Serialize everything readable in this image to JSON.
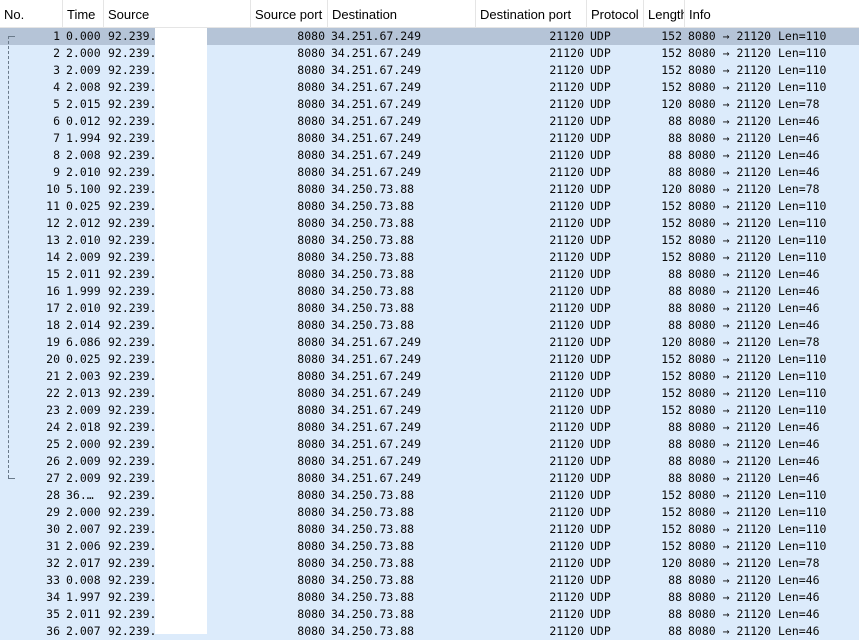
{
  "columns": {
    "no": "No.",
    "time": "Time",
    "source": "Source",
    "source_port": "Source port",
    "destination": "Destination",
    "destination_port": "Destination port",
    "protocol": "Protocol",
    "length": "Length",
    "info": "Info"
  },
  "rows": [
    {
      "no": "1",
      "time": "0.000",
      "src": "92.239.",
      "sport": "8080",
      "dst": "34.251.67.249",
      "dport": "21120",
      "proto": "UDP",
      "len": "152",
      "info": "8080 → 21120 Len=110"
    },
    {
      "no": "2",
      "time": "2.000",
      "src": "92.239.",
      "sport": "8080",
      "dst": "34.251.67.249",
      "dport": "21120",
      "proto": "UDP",
      "len": "152",
      "info": "8080 → 21120 Len=110"
    },
    {
      "no": "3",
      "time": "2.009",
      "src": "92.239.",
      "sport": "8080",
      "dst": "34.251.67.249",
      "dport": "21120",
      "proto": "UDP",
      "len": "152",
      "info": "8080 → 21120 Len=110"
    },
    {
      "no": "4",
      "time": "2.008",
      "src": "92.239.",
      "sport": "8080",
      "dst": "34.251.67.249",
      "dport": "21120",
      "proto": "UDP",
      "len": "152",
      "info": "8080 → 21120 Len=110"
    },
    {
      "no": "5",
      "time": "2.015",
      "src": "92.239.",
      "sport": "8080",
      "dst": "34.251.67.249",
      "dport": "21120",
      "proto": "UDP",
      "len": "120",
      "info": "8080 → 21120 Len=78"
    },
    {
      "no": "6",
      "time": "0.012",
      "src": "92.239.",
      "sport": "8080",
      "dst": "34.251.67.249",
      "dport": "21120",
      "proto": "UDP",
      "len": "88",
      "info": "8080 → 21120 Len=46"
    },
    {
      "no": "7",
      "time": "1.994",
      "src": "92.239.",
      "sport": "8080",
      "dst": "34.251.67.249",
      "dport": "21120",
      "proto": "UDP",
      "len": "88",
      "info": "8080 → 21120 Len=46"
    },
    {
      "no": "8",
      "time": "2.008",
      "src": "92.239.",
      "sport": "8080",
      "dst": "34.251.67.249",
      "dport": "21120",
      "proto": "UDP",
      "len": "88",
      "info": "8080 → 21120 Len=46"
    },
    {
      "no": "9",
      "time": "2.010",
      "src": "92.239.",
      "sport": "8080",
      "dst": "34.251.67.249",
      "dport": "21120",
      "proto": "UDP",
      "len": "88",
      "info": "8080 → 21120 Len=46"
    },
    {
      "no": "10",
      "time": "5.100",
      "src": "92.239.",
      "sport": "8080",
      "dst": "34.250.73.88",
      "dport": "21120",
      "proto": "UDP",
      "len": "120",
      "info": "8080 → 21120 Len=78"
    },
    {
      "no": "11",
      "time": "0.025",
      "src": "92.239.",
      "sport": "8080",
      "dst": "34.250.73.88",
      "dport": "21120",
      "proto": "UDP",
      "len": "152",
      "info": "8080 → 21120 Len=110"
    },
    {
      "no": "12",
      "time": "2.012",
      "src": "92.239.",
      "sport": "8080",
      "dst": "34.250.73.88",
      "dport": "21120",
      "proto": "UDP",
      "len": "152",
      "info": "8080 → 21120 Len=110"
    },
    {
      "no": "13",
      "time": "2.010",
      "src": "92.239.",
      "sport": "8080",
      "dst": "34.250.73.88",
      "dport": "21120",
      "proto": "UDP",
      "len": "152",
      "info": "8080 → 21120 Len=110"
    },
    {
      "no": "14",
      "time": "2.009",
      "src": "92.239.",
      "sport": "8080",
      "dst": "34.250.73.88",
      "dport": "21120",
      "proto": "UDP",
      "len": "152",
      "info": "8080 → 21120 Len=110"
    },
    {
      "no": "15",
      "time": "2.011",
      "src": "92.239.",
      "sport": "8080",
      "dst": "34.250.73.88",
      "dport": "21120",
      "proto": "UDP",
      "len": "88",
      "info": "8080 → 21120 Len=46"
    },
    {
      "no": "16",
      "time": "1.999",
      "src": "92.239.",
      "sport": "8080",
      "dst": "34.250.73.88",
      "dport": "21120",
      "proto": "UDP",
      "len": "88",
      "info": "8080 → 21120 Len=46"
    },
    {
      "no": "17",
      "time": "2.010",
      "src": "92.239.",
      "sport": "8080",
      "dst": "34.250.73.88",
      "dport": "21120",
      "proto": "UDP",
      "len": "88",
      "info": "8080 → 21120 Len=46"
    },
    {
      "no": "18",
      "time": "2.014",
      "src": "92.239.",
      "sport": "8080",
      "dst": "34.250.73.88",
      "dport": "21120",
      "proto": "UDP",
      "len": "88",
      "info": "8080 → 21120 Len=46"
    },
    {
      "no": "19",
      "time": "6.086",
      "src": "92.239.",
      "sport": "8080",
      "dst": "34.251.67.249",
      "dport": "21120",
      "proto": "UDP",
      "len": "120",
      "info": "8080 → 21120 Len=78"
    },
    {
      "no": "20",
      "time": "0.025",
      "src": "92.239.",
      "sport": "8080",
      "dst": "34.251.67.249",
      "dport": "21120",
      "proto": "UDP",
      "len": "152",
      "info": "8080 → 21120 Len=110"
    },
    {
      "no": "21",
      "time": "2.003",
      "src": "92.239.",
      "sport": "8080",
      "dst": "34.251.67.249",
      "dport": "21120",
      "proto": "UDP",
      "len": "152",
      "info": "8080 → 21120 Len=110"
    },
    {
      "no": "22",
      "time": "2.013",
      "src": "92.239.",
      "sport": "8080",
      "dst": "34.251.67.249",
      "dport": "21120",
      "proto": "UDP",
      "len": "152",
      "info": "8080 → 21120 Len=110"
    },
    {
      "no": "23",
      "time": "2.009",
      "src": "92.239.",
      "sport": "8080",
      "dst": "34.251.67.249",
      "dport": "21120",
      "proto": "UDP",
      "len": "152",
      "info": "8080 → 21120 Len=110"
    },
    {
      "no": "24",
      "time": "2.018",
      "src": "92.239.",
      "sport": "8080",
      "dst": "34.251.67.249",
      "dport": "21120",
      "proto": "UDP",
      "len": "88",
      "info": "8080 → 21120 Len=46"
    },
    {
      "no": "25",
      "time": "2.000",
      "src": "92.239.",
      "sport": "8080",
      "dst": "34.251.67.249",
      "dport": "21120",
      "proto": "UDP",
      "len": "88",
      "info": "8080 → 21120 Len=46"
    },
    {
      "no": "26",
      "time": "2.009",
      "src": "92.239.",
      "sport": "8080",
      "dst": "34.251.67.249",
      "dport": "21120",
      "proto": "UDP",
      "len": "88",
      "info": "8080 → 21120 Len=46"
    },
    {
      "no": "27",
      "time": "2.009",
      "src": "92.239.",
      "sport": "8080",
      "dst": "34.251.67.249",
      "dport": "21120",
      "proto": "UDP",
      "len": "88",
      "info": "8080 → 21120 Len=46"
    },
    {
      "no": "28",
      "time": "36.…",
      "src": "92.239.",
      "sport": "8080",
      "dst": "34.250.73.88",
      "dport": "21120",
      "proto": "UDP",
      "len": "152",
      "info": "8080 → 21120 Len=110"
    },
    {
      "no": "29",
      "time": "2.000",
      "src": "92.239.",
      "sport": "8080",
      "dst": "34.250.73.88",
      "dport": "21120",
      "proto": "UDP",
      "len": "152",
      "info": "8080 → 21120 Len=110"
    },
    {
      "no": "30",
      "time": "2.007",
      "src": "92.239.",
      "sport": "8080",
      "dst": "34.250.73.88",
      "dport": "21120",
      "proto": "UDP",
      "len": "152",
      "info": "8080 → 21120 Len=110"
    },
    {
      "no": "31",
      "time": "2.006",
      "src": "92.239.",
      "sport": "8080",
      "dst": "34.250.73.88",
      "dport": "21120",
      "proto": "UDP",
      "len": "152",
      "info": "8080 → 21120 Len=110"
    },
    {
      "no": "32",
      "time": "2.017",
      "src": "92.239.",
      "sport": "8080",
      "dst": "34.250.73.88",
      "dport": "21120",
      "proto": "UDP",
      "len": "120",
      "info": "8080 → 21120 Len=78"
    },
    {
      "no": "33",
      "time": "0.008",
      "src": "92.239.",
      "sport": "8080",
      "dst": "34.250.73.88",
      "dport": "21120",
      "proto": "UDP",
      "len": "88",
      "info": "8080 → 21120 Len=46"
    },
    {
      "no": "34",
      "time": "1.997",
      "src": "92.239.",
      "sport": "8080",
      "dst": "34.250.73.88",
      "dport": "21120",
      "proto": "UDP",
      "len": "88",
      "info": "8080 → 21120 Len=46"
    },
    {
      "no": "35",
      "time": "2.011",
      "src": "92.239.",
      "sport": "8080",
      "dst": "34.250.73.88",
      "dport": "21120",
      "proto": "UDP",
      "len": "88",
      "info": "8080 → 21120 Len=46"
    },
    {
      "no": "36",
      "time": "2.007",
      "src": "92.239.",
      "sport": "8080",
      "dst": "34.250.73.88",
      "dport": "21120",
      "proto": "UDP",
      "len": "88",
      "info": "8080 → 21120 Len=46"
    }
  ],
  "selected_row": 0,
  "colors": {
    "row_background": "#dcebfb",
    "selected_row_background": "#b5c4d7",
    "header_background": "#ffffff"
  }
}
